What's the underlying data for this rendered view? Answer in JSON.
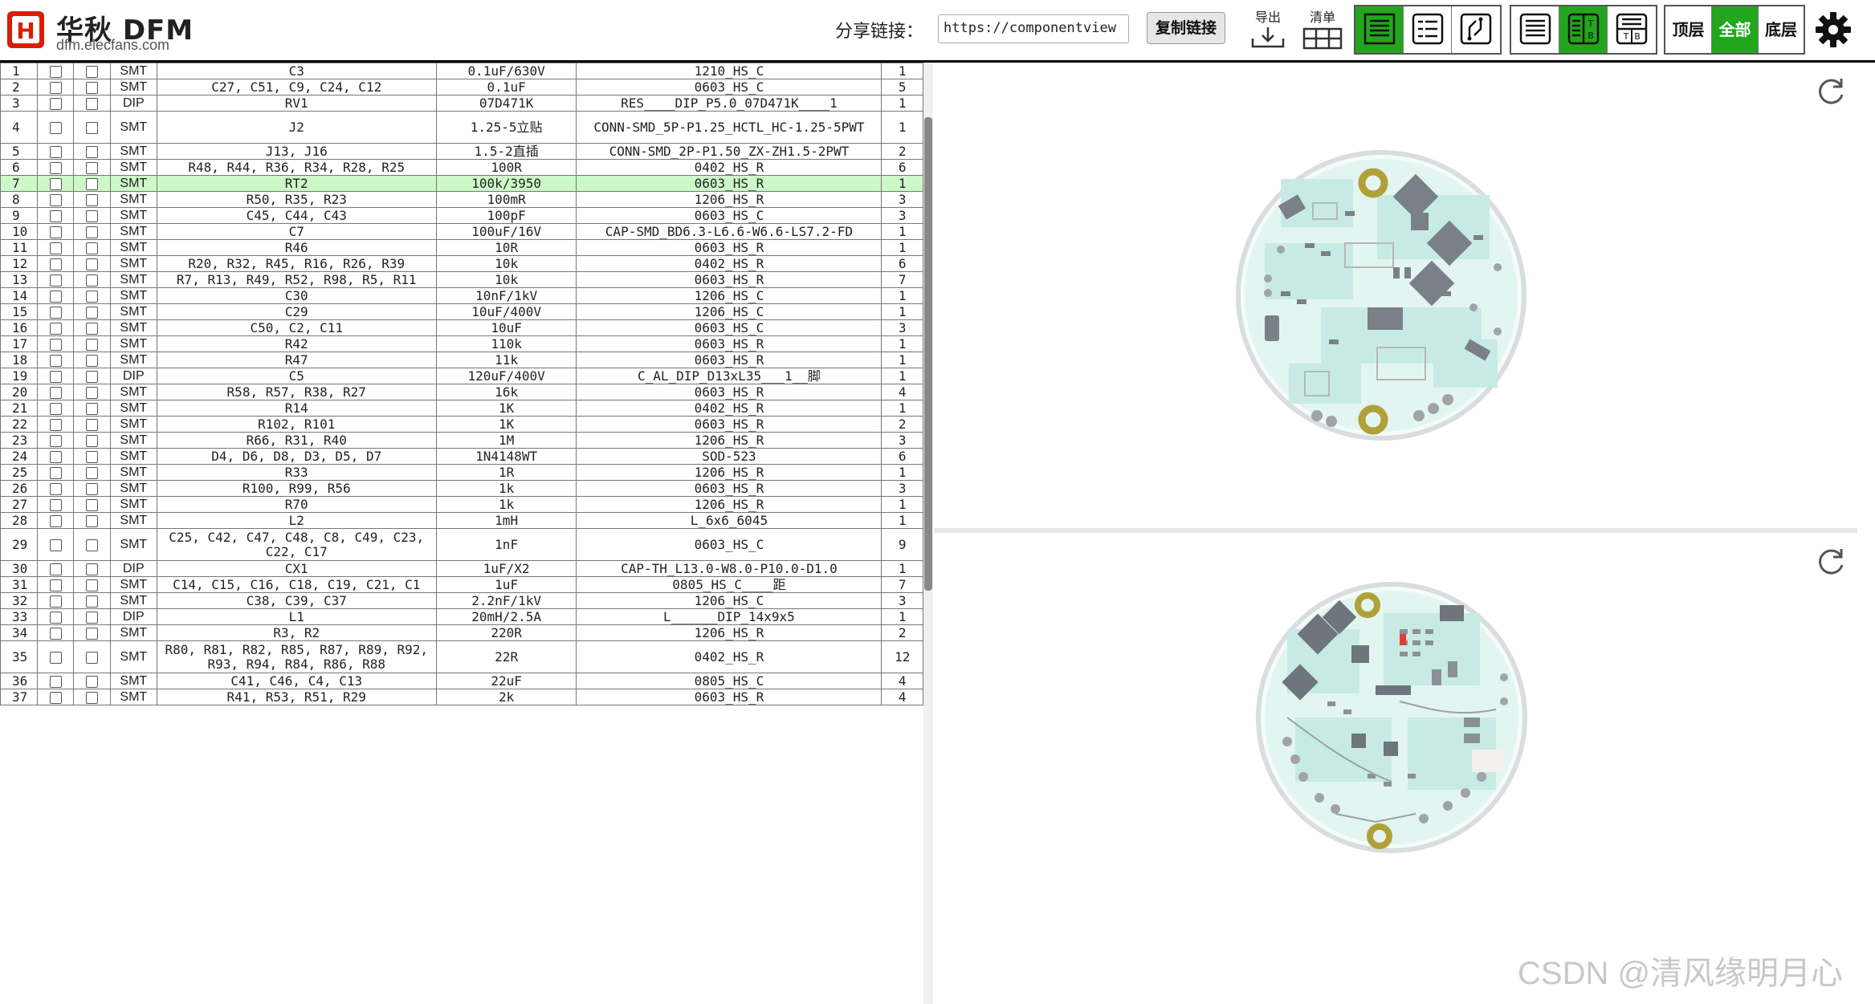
{
  "header": {
    "logo_text": "华秋 DFM",
    "logo_domain": "dfm.elecfans.com",
    "share_label": "分享链接：",
    "share_url": "https://componentview",
    "copy_button": "复制链接",
    "export_label": "导出",
    "list_label": "清单",
    "layer_buttons": [
      "顶层",
      "全部",
      "底层"
    ],
    "active_layer": "全部",
    "accent_color": "#22a61e"
  },
  "bom_rows": [
    {
      "no": "1",
      "type": "SMT",
      "ref": "C3",
      "value": "0.1uF/630V",
      "package": "1210_HS_C",
      "qty": "1"
    },
    {
      "no": "2",
      "type": "SMT",
      "ref": "C27, C51, C9, C24, C12",
      "value": "0.1uF",
      "package": "0603_HS_C",
      "qty": "5"
    },
    {
      "no": "3",
      "type": "DIP",
      "ref": "RV1",
      "value": "07D471K",
      "package": "RES____DIP_P5.0_07D471K____1",
      "qty": "1"
    },
    {
      "no": "4",
      "type": "SMT",
      "ref": "J2",
      "value": "1.25-5立贴",
      "package": "CONN-SMD_5P-P1.25_HCTL_HC-1.25-5PWT",
      "qty": "1"
    },
    {
      "no": "5",
      "type": "SMT",
      "ref": "J13, J16",
      "value": "1.5-2直插",
      "package": "CONN-SMD_2P-P1.50_ZX-ZH1.5-2PWT",
      "qty": "2"
    },
    {
      "no": "6",
      "type": "SMT",
      "ref": "R48, R44, R36, R34, R28, R25",
      "value": "100R",
      "package": "0402_HS_R",
      "qty": "6"
    },
    {
      "no": "7",
      "type": "SMT",
      "ref": "RT2",
      "value": "100k/3950",
      "package": "0603_HS_R",
      "qty": "1",
      "selected": true
    },
    {
      "no": "8",
      "type": "SMT",
      "ref": "R50, R35, R23",
      "value": "100mR",
      "package": "1206_HS_R",
      "qty": "3"
    },
    {
      "no": "9",
      "type": "SMT",
      "ref": "C45, C44, C43",
      "value": "100pF",
      "package": "0603_HS_C",
      "qty": "3"
    },
    {
      "no": "10",
      "type": "SMT",
      "ref": "C7",
      "value": "100uF/16V",
      "package": "CAP-SMD_BD6.3-L6.6-W6.6-LS7.2-FD",
      "qty": "1"
    },
    {
      "no": "11",
      "type": "SMT",
      "ref": "R46",
      "value": "10R",
      "package": "0603_HS_R",
      "qty": "1"
    },
    {
      "no": "12",
      "type": "SMT",
      "ref": "R20, R32, R45, R16, R26, R39",
      "value": "10k",
      "package": "0402_HS_R",
      "qty": "6"
    },
    {
      "no": "13",
      "type": "SMT",
      "ref": "R7, R13, R49, R52, R98, R5, R11",
      "value": "10k",
      "package": "0603_HS_R",
      "qty": "7"
    },
    {
      "no": "14",
      "type": "SMT",
      "ref": "C30",
      "value": "10nF/1kV",
      "package": "1206_HS_C",
      "qty": "1"
    },
    {
      "no": "15",
      "type": "SMT",
      "ref": "C29",
      "value": "10uF/400V",
      "package": "1206_HS_C",
      "qty": "1"
    },
    {
      "no": "16",
      "type": "SMT",
      "ref": "C50, C2, C11",
      "value": "10uF",
      "package": "0603_HS_C",
      "qty": "3"
    },
    {
      "no": "17",
      "type": "SMT",
      "ref": "R42",
      "value": "110k",
      "package": "0603_HS_R",
      "qty": "1"
    },
    {
      "no": "18",
      "type": "SMT",
      "ref": "R47",
      "value": "11k",
      "package": "0603_HS_R",
      "qty": "1"
    },
    {
      "no": "19",
      "type": "DIP",
      "ref": "C5",
      "value": "120uF/400V",
      "package": "C_AL_DIP_D13xL35___1__脚",
      "qty": "1"
    },
    {
      "no": "20",
      "type": "SMT",
      "ref": "R58, R57, R38, R27",
      "value": "16k",
      "package": "0603_HS_R",
      "qty": "4"
    },
    {
      "no": "21",
      "type": "SMT",
      "ref": "R14",
      "value": "1K",
      "package": "0402_HS_R",
      "qty": "1"
    },
    {
      "no": "22",
      "type": "SMT",
      "ref": "R102, R101",
      "value": "1K",
      "package": "0603_HS_R",
      "qty": "2"
    },
    {
      "no": "23",
      "type": "SMT",
      "ref": "R66, R31, R40",
      "value": "1M",
      "package": "1206_HS_R",
      "qty": "3"
    },
    {
      "no": "24",
      "type": "SMT",
      "ref": "D4, D6, D8, D3, D5, D7",
      "value": "1N4148WT",
      "package": "SOD-523",
      "qty": "6"
    },
    {
      "no": "25",
      "type": "SMT",
      "ref": "R33",
      "value": "1R",
      "package": "1206_HS_R",
      "qty": "1"
    },
    {
      "no": "26",
      "type": "SMT",
      "ref": "R100, R99, R56",
      "value": "1k",
      "package": "0603_HS_R",
      "qty": "3"
    },
    {
      "no": "27",
      "type": "SMT",
      "ref": "R70",
      "value": "1k",
      "package": "1206_HS_R",
      "qty": "1"
    },
    {
      "no": "28",
      "type": "SMT",
      "ref": "L2",
      "value": "1mH",
      "package": "L_6x6_6045",
      "qty": "1"
    },
    {
      "no": "29",
      "type": "SMT",
      "ref": "C25, C42, C47, C48, C8, C49, C23, C22, C17",
      "value": "1nF",
      "package": "0603_HS_C",
      "qty": "9"
    },
    {
      "no": "30",
      "type": "DIP",
      "ref": "CX1",
      "value": "1uF/X2",
      "package": "CAP-TH_L13.0-W8.0-P10.0-D1.0",
      "qty": "1"
    },
    {
      "no": "31",
      "type": "SMT",
      "ref": "C14, C15, C16, C18, C19, C21, C1",
      "value": "1uF",
      "package": "0805_HS_C____距",
      "qty": "7"
    },
    {
      "no": "32",
      "type": "SMT",
      "ref": "C38, C39, C37",
      "value": "2.2nF/1kV",
      "package": "1206_HS_C",
      "qty": "3"
    },
    {
      "no": "33",
      "type": "DIP",
      "ref": "L1",
      "value": "20mH/2.5A",
      "package": "L______DIP_14x9x5",
      "qty": "1"
    },
    {
      "no": "34",
      "type": "SMT",
      "ref": "R3, R2",
      "value": "220R",
      "package": "1206_HS_R",
      "qty": "2"
    },
    {
      "no": "35",
      "type": "SMT",
      "ref": "R80, R81, R82, R85, R87, R89, R92, R93, R94, R84, R86, R88",
      "value": "22R",
      "package": "0402_HS_R",
      "qty": "12"
    },
    {
      "no": "36",
      "type": "SMT",
      "ref": "C41, C46, C4, C13",
      "value": "22uF",
      "package": "0805_HS_C",
      "qty": "4"
    },
    {
      "no": "37",
      "type": "SMT",
      "ref": "R41, R53, R51, R29",
      "value": "2k",
      "package": "0603_HS_R",
      "qty": "4"
    }
  ],
  "watermark": "CSDN @清风缘明月心"
}
